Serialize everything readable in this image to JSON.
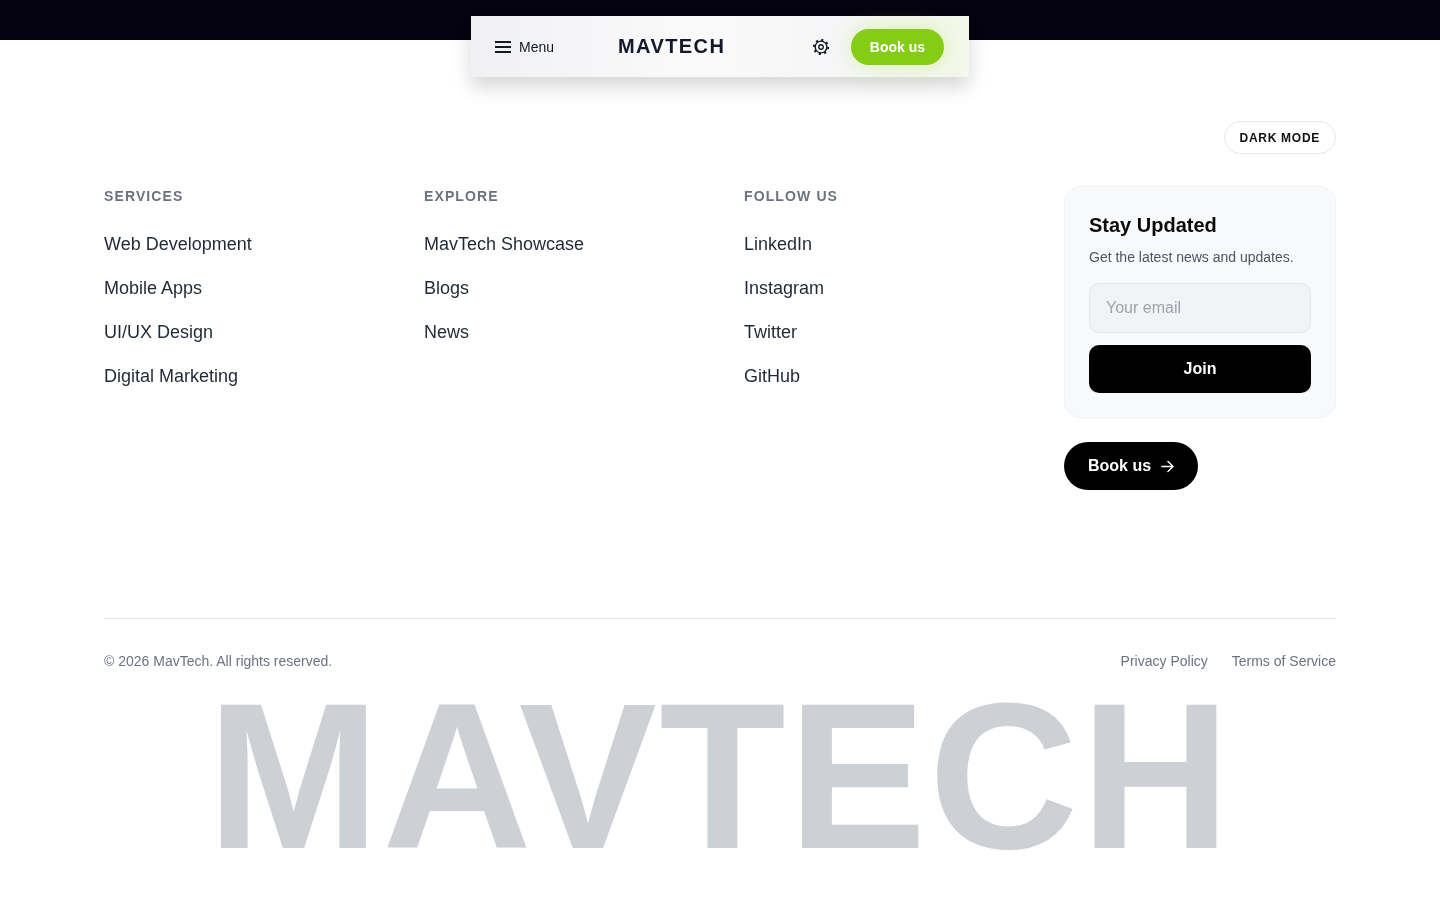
{
  "top_bar": {
    "menu_label": "Menu",
    "logo": "MAVTECH",
    "book_button": "Book us"
  },
  "dark_mode_button": "DARK MODE",
  "link_columns": [
    {
      "heading": "SERVICES",
      "links": [
        "Web Development",
        "Mobile Apps",
        "UI/UX Design",
        "Digital Marketing"
      ]
    },
    {
      "heading": "EXPLORE",
      "links": [
        "MavTech Showcase",
        "Blogs",
        "News"
      ]
    },
    {
      "heading": "FOLLOW US",
      "links": [
        "LinkedIn",
        "Instagram",
        "Twitter",
        "GitHub"
      ]
    }
  ],
  "newsletter": {
    "title": "Stay Updated",
    "subtitle": "Get the latest news and updates.",
    "email_field": {
      "placeholder": "Your email"
    },
    "button": "Join"
  },
  "book_button": "Book us",
  "footer": {
    "copyright": "© 2026 MavTech. All rights reserved.",
    "links": [
      "Privacy Policy",
      "Terms of Service"
    ],
    "wordmark": "MAVTECH"
  }
}
